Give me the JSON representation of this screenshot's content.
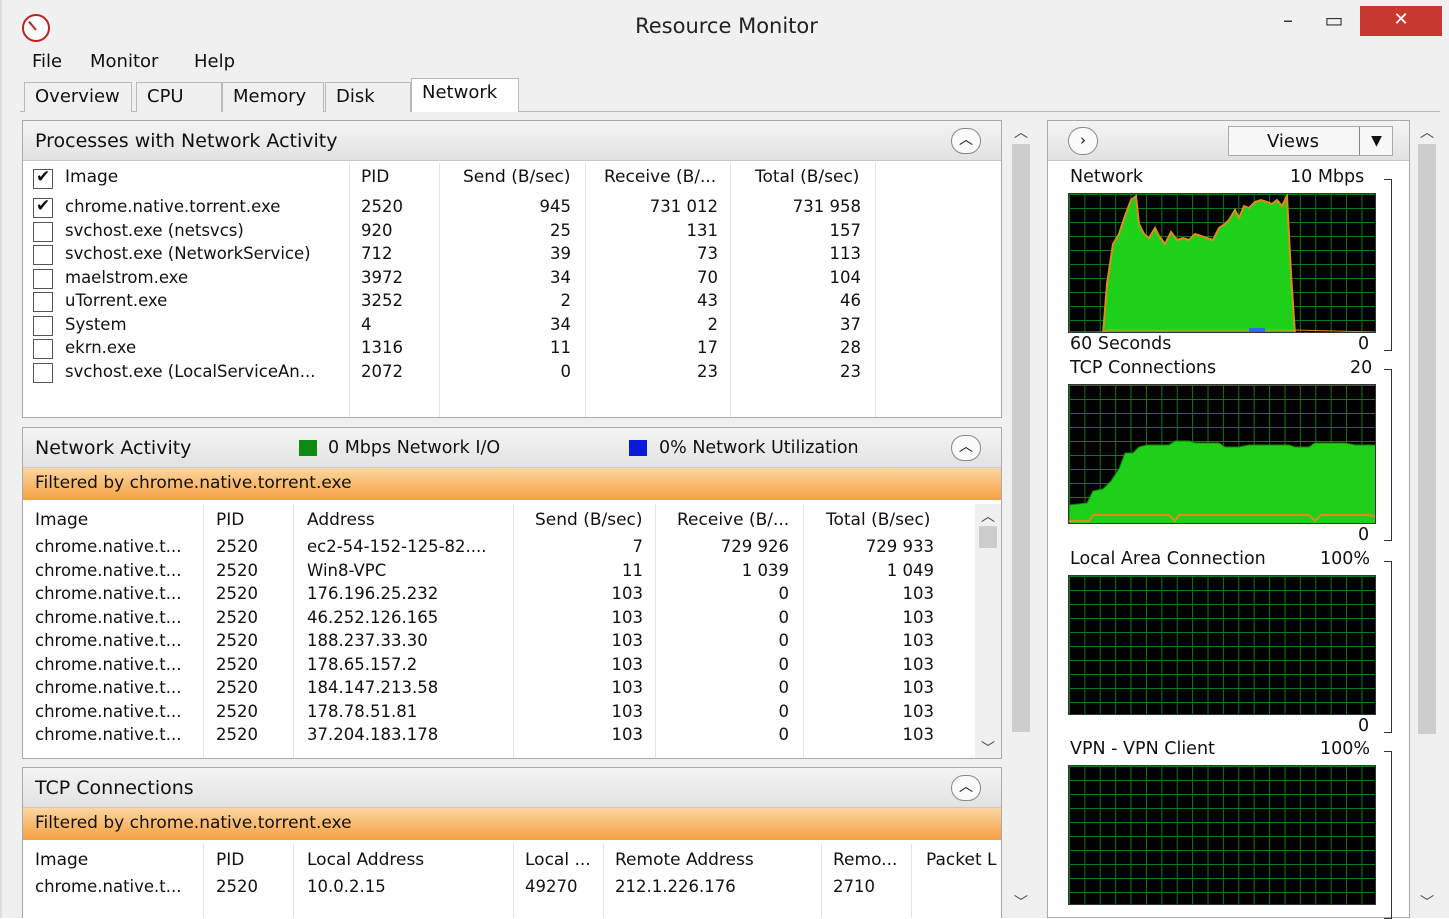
{
  "window": {
    "title": "Resource Monitor",
    "minimize_glyph": "–",
    "maximize_glyph": "▭",
    "close_glyph": "✕"
  },
  "menu": [
    "File",
    "Monitor",
    "Help"
  ],
  "tabs": [
    "Overview",
    "CPU",
    "Memory",
    "Disk",
    "Network"
  ],
  "active_tab": "Network",
  "processes": {
    "title": "Processes with Network Activity",
    "columns": [
      "Image",
      "PID",
      "Send (B/sec)",
      "Receive (B/...",
      "Total (B/sec)"
    ],
    "rows": [
      {
        "image": "chrome.native.torrent.exe",
        "pid": "2520",
        "send": "945",
        "receive": "731 012",
        "total": "731 958",
        "checked": true
      },
      {
        "image": "svchost.exe (netsvcs)",
        "pid": "920",
        "send": "25",
        "receive": "131",
        "total": "157",
        "checked": false
      },
      {
        "image": "svchost.exe (NetworkService)",
        "pid": "712",
        "send": "39",
        "receive": "73",
        "total": "113",
        "checked": false
      },
      {
        "image": "maelstrom.exe",
        "pid": "3972",
        "send": "34",
        "receive": "70",
        "total": "104",
        "checked": false
      },
      {
        "image": "uTorrent.exe",
        "pid": "3252",
        "send": "2",
        "receive": "43",
        "total": "46",
        "checked": false
      },
      {
        "image": "System",
        "pid": "4",
        "send": "34",
        "receive": "2",
        "total": "37",
        "checked": false
      },
      {
        "image": "ekrn.exe",
        "pid": "1316",
        "send": "11",
        "receive": "17",
        "total": "28",
        "checked": false
      },
      {
        "image": "svchost.exe (LocalServiceAn...",
        "pid": "2072",
        "send": "0",
        "receive": "23",
        "total": "23",
        "checked": false
      }
    ]
  },
  "network_activity": {
    "title": "Network Activity",
    "io_legend": "0 Mbps Network I/O",
    "util_legend": "0% Network Utilization",
    "io_color": "#0c8a12",
    "util_color": "#0a1adb",
    "filter": "Filtered by chrome.native.torrent.exe",
    "columns": [
      "Image",
      "PID",
      "Address",
      "Send (B/sec)",
      "Receive (B/...",
      "Total (B/sec)"
    ],
    "rows": [
      {
        "image": "chrome.native.t...",
        "pid": "2520",
        "address": "ec2-54-152-125-82....",
        "send": "7",
        "receive": "729 926",
        "total": "729 933"
      },
      {
        "image": "chrome.native.t...",
        "pid": "2520",
        "address": "Win8-VPC",
        "send": "11",
        "receive": "1 039",
        "total": "1 049"
      },
      {
        "image": "chrome.native.t...",
        "pid": "2520",
        "address": "176.196.25.232",
        "send": "103",
        "receive": "0",
        "total": "103"
      },
      {
        "image": "chrome.native.t...",
        "pid": "2520",
        "address": "46.252.126.165",
        "send": "103",
        "receive": "0",
        "total": "103"
      },
      {
        "image": "chrome.native.t...",
        "pid": "2520",
        "address": "188.237.33.30",
        "send": "103",
        "receive": "0",
        "total": "103"
      },
      {
        "image": "chrome.native.t...",
        "pid": "2520",
        "address": "178.65.157.2",
        "send": "103",
        "receive": "0",
        "total": "103"
      },
      {
        "image": "chrome.native.t...",
        "pid": "2520",
        "address": "184.147.213.58",
        "send": "103",
        "receive": "0",
        "total": "103"
      },
      {
        "image": "chrome.native.t...",
        "pid": "2520",
        "address": "178.78.51.81",
        "send": "103",
        "receive": "0",
        "total": "103"
      },
      {
        "image": "chrome.native.t...",
        "pid": "2520",
        "address": "37.204.183.178",
        "send": "103",
        "receive": "0",
        "total": "103"
      }
    ]
  },
  "tcp_connections": {
    "title": "TCP Connections",
    "filter": "Filtered by chrome.native.torrent.exe",
    "columns": [
      "Image",
      "PID",
      "Local Address",
      "Local ...",
      "Remote Address",
      "Remo...",
      "Packet L"
    ],
    "rows": [
      {
        "image": "chrome.native.t...",
        "pid": "2520",
        "local_address": "10.0.2.15",
        "local_port": "49270",
        "remote_address": "212.1.226.176",
        "remote_port": "2710"
      }
    ]
  },
  "graphs_panel": {
    "views_label": "Views",
    "graphs": [
      {
        "name": "Network",
        "max": "10 Mbps",
        "footer_left": "60 Seconds",
        "footer_right": "0"
      },
      {
        "name": "TCP Connections",
        "max": "20",
        "footer_left": "",
        "footer_right": "0"
      },
      {
        "name": "Local Area Connection",
        "max": "100%",
        "footer_left": "",
        "footer_right": "0"
      },
      {
        "name": "VPN - VPN Client",
        "max": "100%",
        "footer_left": "",
        "footer_right": ""
      }
    ]
  }
}
